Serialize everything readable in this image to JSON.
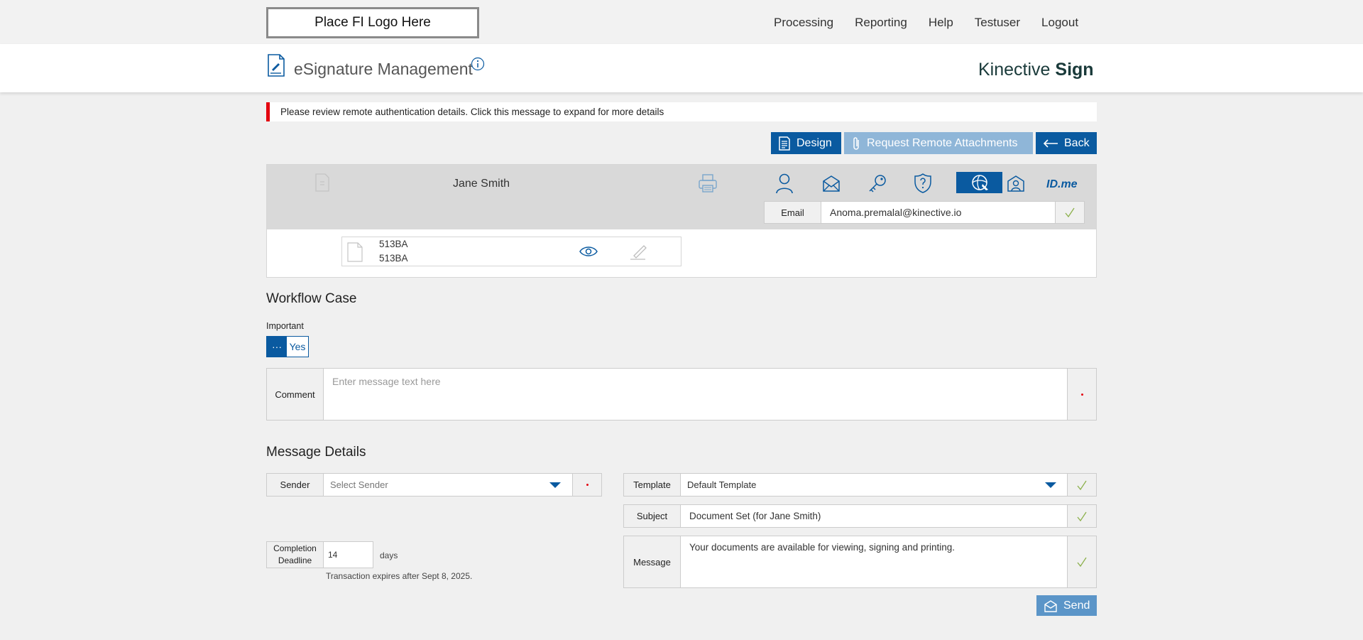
{
  "topbar": {
    "logo_text": "Place FI Logo Here",
    "nav": [
      "Processing",
      "Reporting",
      "Help",
      "Testuser",
      "Logout"
    ]
  },
  "header": {
    "app_title": "eSignature Management",
    "brand_prefix": "Kinective",
    "brand_suffix": "Sign"
  },
  "alert": {
    "text": "Please review remote authentication details. Click this message to expand for more details",
    "color": "#e3000f"
  },
  "actions": {
    "design": "Design",
    "request_attachments": "Request Remote Attachments",
    "back": "Back"
  },
  "signer": {
    "name": "Jane Smith",
    "auth_methods": [
      "person-icon",
      "email-auth-icon",
      "key-auth-icon",
      "question-shield-icon",
      "remote-signing-icon",
      "in-person-icon",
      "ID.me"
    ],
    "active_auth": "remote-signing-icon",
    "idme": "ID.me",
    "email_label": "Email",
    "email_value": "Anoma.premalal@kinective.io",
    "document": {
      "name_line1": "513BA",
      "name_line2": "513BA"
    }
  },
  "workflow": {
    "title": "Workflow Case",
    "important_label": "Important",
    "important_knob": "···",
    "important_value": "Yes",
    "comment_label": "Comment",
    "comment_placeholder": "Enter message text here"
  },
  "message_details": {
    "title": "Message Details",
    "sender_label": "Sender",
    "sender_placeholder": "Select Sender",
    "template_label": "Template",
    "template_value": "Default Template",
    "subject_label": "Subject",
    "subject_value": "Document Set (for Jane Smith)",
    "message_label": "Message",
    "message_value": "Your documents are available for viewing, signing and printing.",
    "deadline_label": "Completion Deadline",
    "deadline_value": "14",
    "deadline_unit": "days",
    "expiry_text": "Transaction expires after Sept 8, 2025.",
    "send": "Send"
  },
  "colors": {
    "primary": "#0a5aa0",
    "primary_light": "#8fb6d8",
    "required": "#e3000f",
    "check": "#8bb04a"
  }
}
